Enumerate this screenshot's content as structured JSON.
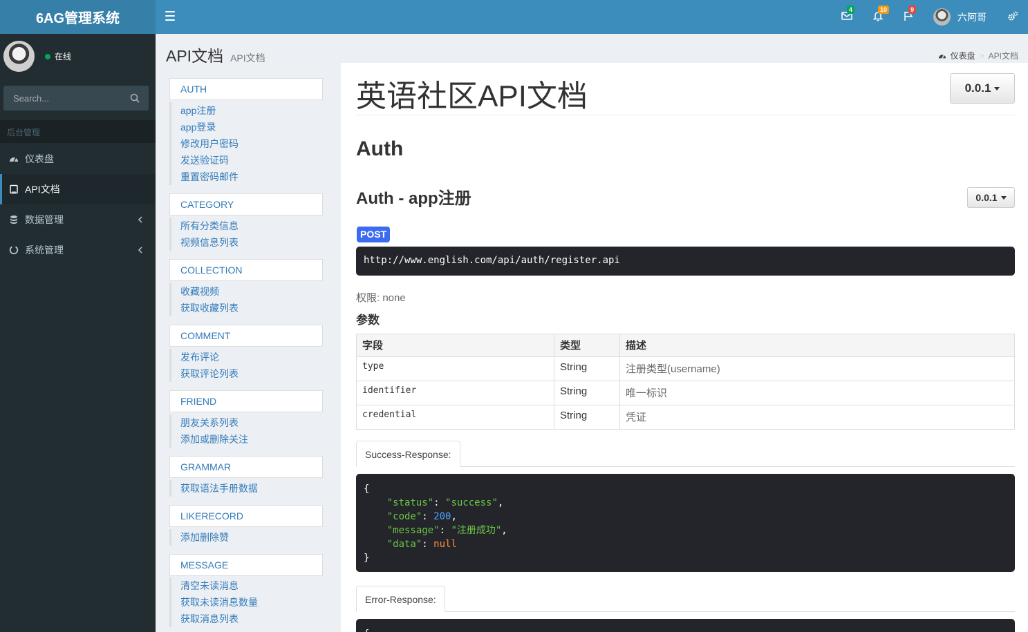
{
  "app": {
    "logo": "6AG管理系统"
  },
  "navbar": {
    "mail_count": "4",
    "notif_count": "10",
    "flag_count": "9",
    "user_name": "六阿哥",
    "badge_colors": {
      "mail": "#00a65a",
      "notif": "#f39c12",
      "flag": "#dd4b39"
    }
  },
  "sidebar": {
    "status": "在线",
    "search_placeholder": "Search...",
    "header": "后台管理",
    "items": [
      {
        "label": "仪表盘",
        "icon": "dashboard-icon"
      },
      {
        "label": "API文档",
        "icon": "book-icon"
      },
      {
        "label": "数据管理",
        "icon": "database-icon"
      },
      {
        "label": "系统管理",
        "icon": "circle-notch-icon"
      }
    ]
  },
  "content_header": {
    "title": "API文档",
    "subtitle": "API文档",
    "breadcrumb": [
      "仪表盘",
      "API文档"
    ]
  },
  "doc_nav": {
    "groups": [
      {
        "title": "AUTH",
        "links": [
          "app注册",
          "app登录",
          "修改用户密码",
          "发送验证码",
          "重置密码邮件"
        ]
      },
      {
        "title": "CATEGORY",
        "links": [
          "所有分类信息",
          "视频信息列表"
        ]
      },
      {
        "title": "COLLECTION",
        "links": [
          "收藏视频",
          "获取收藏列表"
        ]
      },
      {
        "title": "COMMENT",
        "links": [
          "发布评论",
          "获取评论列表"
        ]
      },
      {
        "title": "FRIEND",
        "links": [
          "朋友关系列表",
          "添加或删除关注"
        ]
      },
      {
        "title": "GRAMMAR",
        "links": [
          "获取语法手册数据"
        ]
      },
      {
        "title": "LIKERECORD",
        "links": [
          "添加删除赞"
        ]
      },
      {
        "title": "MESSAGE",
        "links": [
          "清空未读消息",
          "获取未读消息数量",
          "获取消息列表"
        ]
      }
    ]
  },
  "doc": {
    "title": "英语社区API文档",
    "version": "0.0.1",
    "section": "Auth",
    "api_title": "Auth - app注册",
    "api_version": "0.0.1",
    "method": "POST",
    "url": "http://www.english.com/api/auth/register.api",
    "permission": "权限: none",
    "params_heading": "参数",
    "params_headers": [
      "字段",
      "类型",
      "描述"
    ],
    "params": [
      {
        "field": "type",
        "type": "String",
        "desc": "注册类型(username)"
      },
      {
        "field": "identifier",
        "type": "String",
        "desc": "唯一标识"
      },
      {
        "field": "credential",
        "type": "String",
        "desc": "凭证"
      }
    ],
    "success_tab": "Success-Response:",
    "success_json": {
      "open": "{",
      "status_key": "\"status\"",
      "status_val": "\"success\"",
      "code_key": "\"code\"",
      "code_val": "200",
      "message_key": "\"message\"",
      "message_val": "\"注册成功\"",
      "data_key": "\"data\"",
      "data_val": "null",
      "close": "}"
    },
    "error_tab": "Error-Response:",
    "error_open": "{"
  }
}
